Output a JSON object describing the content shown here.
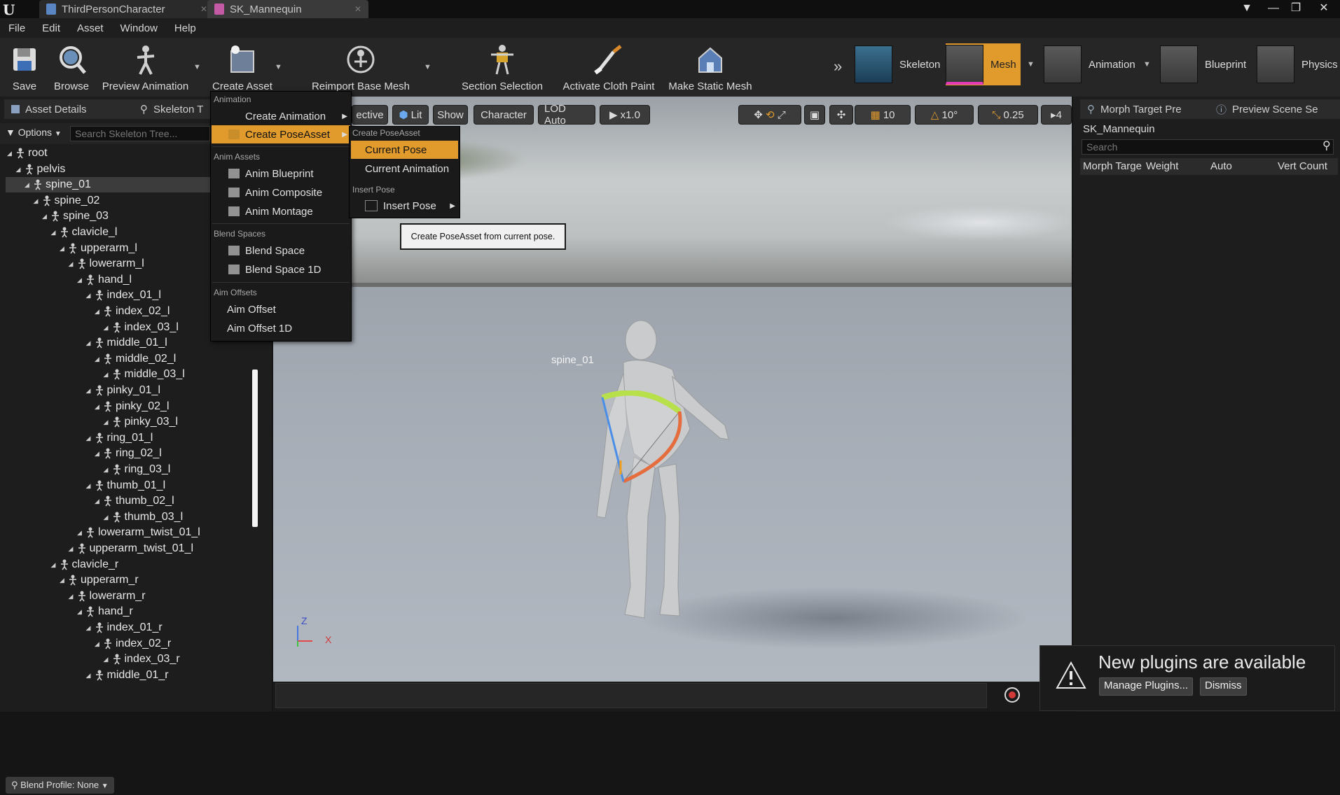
{
  "window": {
    "tabs": [
      {
        "label": "ThirdPersonCharacter"
      },
      {
        "label": "SK_Mannequin"
      }
    ]
  },
  "menubar": [
    "File",
    "Edit",
    "Asset",
    "Window",
    "Help"
  ],
  "toolbar": {
    "buttons": [
      {
        "label": "Save",
        "icon": "save-icon"
      },
      {
        "label": "Browse",
        "icon": "browse-icon"
      },
      {
        "label": "Preview Animation",
        "icon": "preview-animation-icon"
      },
      {
        "label": "Create Asset",
        "icon": "create-asset-icon"
      },
      {
        "label": "Reimport Base Mesh",
        "icon": "reimport-icon"
      },
      {
        "label": "Section Selection",
        "icon": "section-selection-icon"
      },
      {
        "label": "Activate Cloth Paint",
        "icon": "cloth-paint-icon"
      },
      {
        "label": "Make Static Mesh",
        "icon": "static-mesh-icon"
      }
    ],
    "modes": [
      {
        "label": "Skeleton"
      },
      {
        "label": "Mesh",
        "active": true
      },
      {
        "label": "Animation"
      },
      {
        "label": "Blueprint"
      },
      {
        "label": "Physics"
      }
    ]
  },
  "left_panel": {
    "tabs": [
      "Asset Details",
      "Skeleton T"
    ],
    "options_label": "Options",
    "search_placeholder": "Search Skeleton Tree...",
    "tree": [
      {
        "label": "root",
        "depth": 0
      },
      {
        "label": "pelvis",
        "depth": 1
      },
      {
        "label": "spine_01",
        "depth": 2,
        "selected": true
      },
      {
        "label": "spine_02",
        "depth": 3
      },
      {
        "label": "spine_03",
        "depth": 4
      },
      {
        "label": "clavicle_l",
        "depth": 5
      },
      {
        "label": "upperarm_l",
        "depth": 6
      },
      {
        "label": "lowerarm_l",
        "depth": 7
      },
      {
        "label": "hand_l",
        "depth": 8
      },
      {
        "label": "index_01_l",
        "depth": 9
      },
      {
        "label": "index_02_l",
        "depth": 10
      },
      {
        "label": "index_03_l",
        "depth": 11
      },
      {
        "label": "middle_01_l",
        "depth": 9
      },
      {
        "label": "middle_02_l",
        "depth": 10
      },
      {
        "label": "middle_03_l",
        "depth": 11
      },
      {
        "label": "pinky_01_l",
        "depth": 9
      },
      {
        "label": "pinky_02_l",
        "depth": 10
      },
      {
        "label": "pinky_03_l",
        "depth": 11
      },
      {
        "label": "ring_01_l",
        "depth": 9
      },
      {
        "label": "ring_02_l",
        "depth": 10
      },
      {
        "label": "ring_03_l",
        "depth": 11
      },
      {
        "label": "thumb_01_l",
        "depth": 9
      },
      {
        "label": "thumb_02_l",
        "depth": 10
      },
      {
        "label": "thumb_03_l",
        "depth": 11
      },
      {
        "label": "lowerarm_twist_01_l",
        "depth": 8
      },
      {
        "label": "upperarm_twist_01_l",
        "depth": 7
      },
      {
        "label": "clavicle_r",
        "depth": 5
      },
      {
        "label": "upperarm_r",
        "depth": 6
      },
      {
        "label": "lowerarm_r",
        "depth": 7
      },
      {
        "label": "hand_r",
        "depth": 8
      },
      {
        "label": "index_01_r",
        "depth": 9
      },
      {
        "label": "index_02_r",
        "depth": 10
      },
      {
        "label": "index_03_r",
        "depth": 11
      },
      {
        "label": "middle_01_r",
        "depth": 9
      }
    ],
    "blend_profile": "Blend Profile: None"
  },
  "viewport": {
    "buttons": [
      "ective",
      "Lit",
      "Show",
      "Character",
      "LOD Auto",
      "x1.0"
    ],
    "snap": {
      "grid": "10",
      "rotation": "10°",
      "scale": "0.25",
      "camera_speed": "4"
    },
    "bone_label": "spine_01",
    "axis": {
      "z": "Z",
      "x": "X"
    }
  },
  "right_panel": {
    "tabs": [
      "Morph Target Pre",
      "Preview Scene Se"
    ],
    "asset_name": "SK_Mannequin",
    "search_placeholder": "Search",
    "columns": [
      "Morph Targe",
      "Weight",
      "Auto",
      "Vert Count"
    ]
  },
  "context_menu": {
    "sections": [
      {
        "header": "Animation",
        "items": [
          {
            "label": "Create Animation",
            "submenu": true
          },
          {
            "label": "Create PoseAsset",
            "submenu": true,
            "selected": true
          }
        ]
      },
      {
        "header": "Anim Assets",
        "items": [
          {
            "label": "Anim Blueprint"
          },
          {
            "label": "Anim Composite"
          },
          {
            "label": "Anim Montage"
          }
        ]
      },
      {
        "header": "Blend Spaces",
        "items": [
          {
            "label": "Blend Space"
          },
          {
            "label": "Blend Space 1D"
          }
        ]
      },
      {
        "header": "Aim Offsets",
        "items": [
          {
            "label": "Aim Offset"
          },
          {
            "label": "Aim Offset 1D"
          }
        ]
      }
    ],
    "submenu": {
      "header1": "Create PoseAsset",
      "items1": [
        "Current Pose",
        "Current Animation"
      ],
      "header2": "Insert Pose",
      "items2": [
        "Insert Pose"
      ]
    },
    "tooltip": "Create PoseAsset from current pose."
  },
  "notification": {
    "title": "New plugins are available",
    "manage_label": "Manage Plugins...",
    "dismiss_label": "Dismiss"
  },
  "colors": {
    "accent": "#e19b2c"
  }
}
